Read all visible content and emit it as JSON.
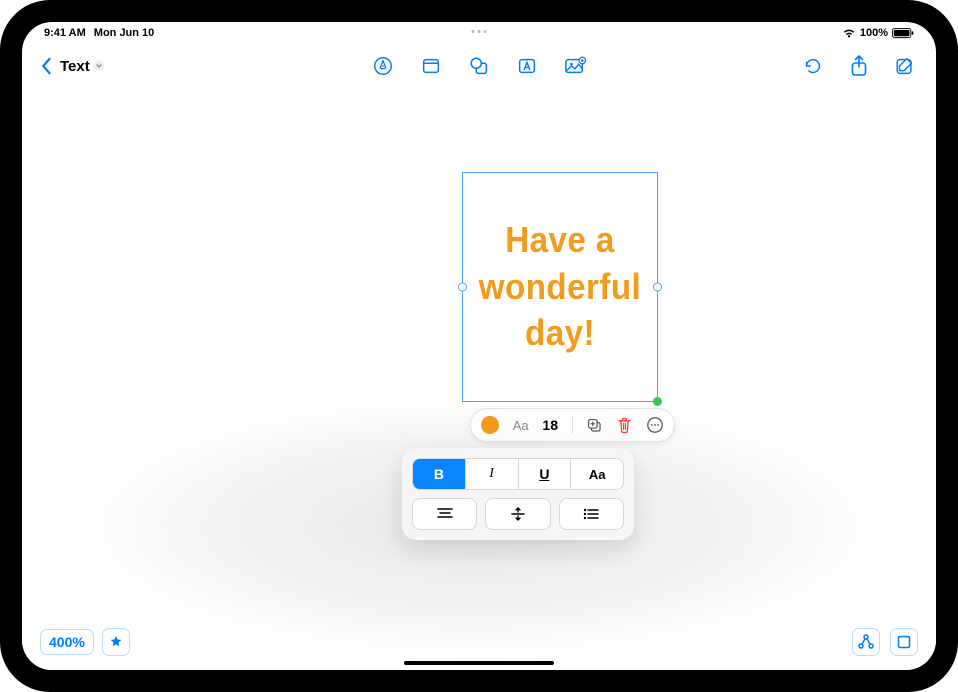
{
  "status": {
    "time": "9:41 AM",
    "date": "Mon Jun 10",
    "battery": "100%"
  },
  "header": {
    "title": "Text"
  },
  "textbox": {
    "content": "Have a wonderful day!"
  },
  "popover": {
    "font_label": "Aa",
    "size": "18",
    "bold": "B",
    "italic": "I",
    "underline": "U",
    "case": "Aa"
  },
  "bottom": {
    "zoom": "400%"
  },
  "colors": {
    "accent": "#007aff",
    "text_color": "#f29b1c"
  }
}
